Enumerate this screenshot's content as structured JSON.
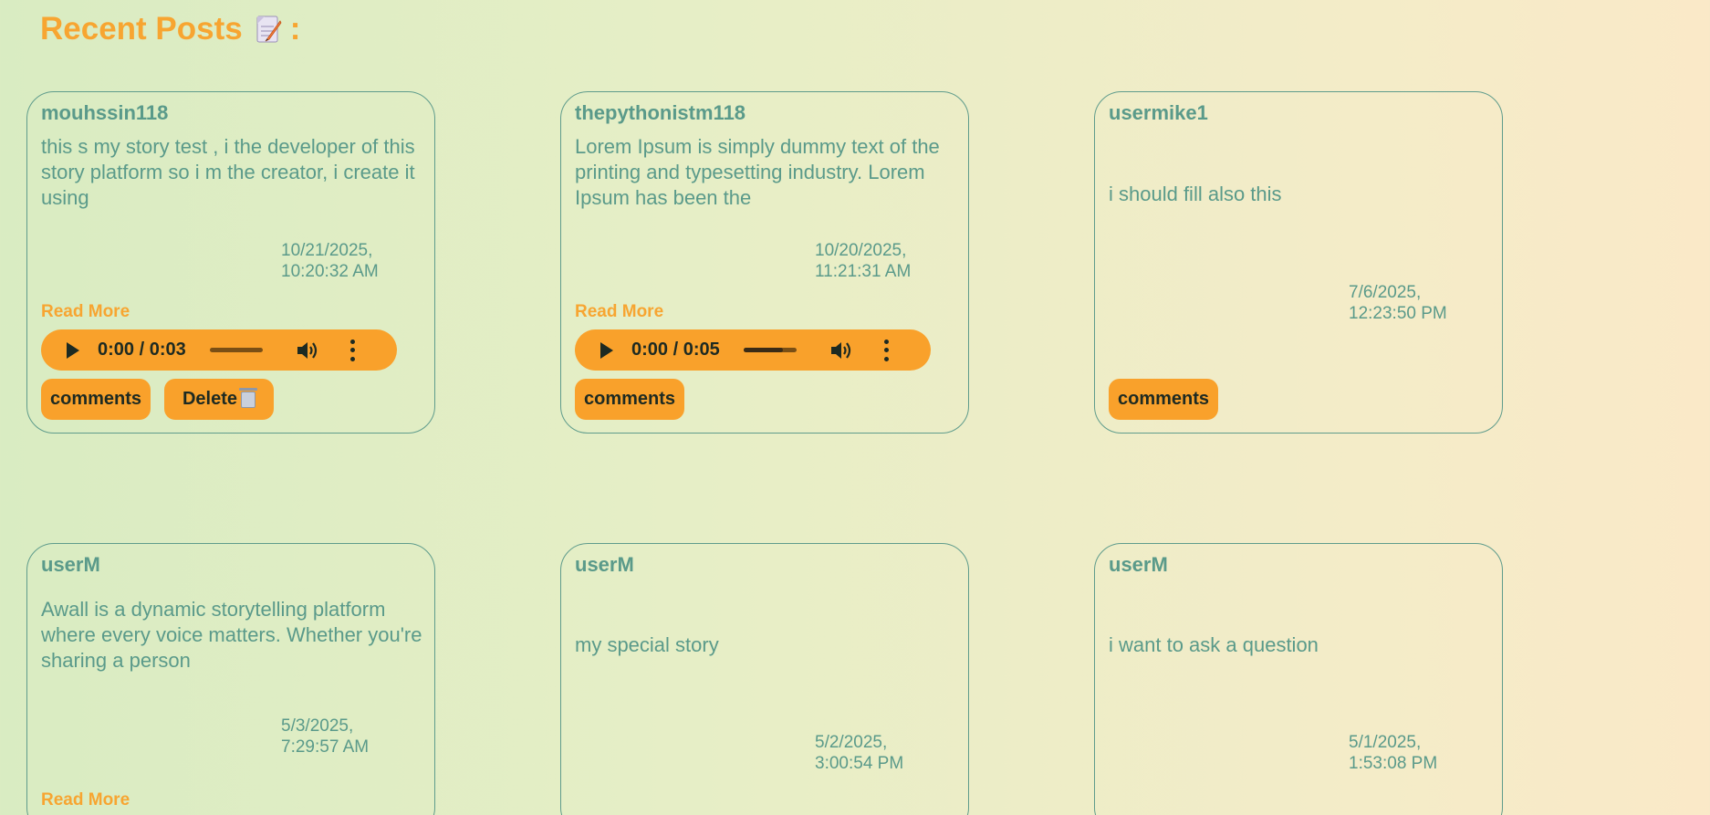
{
  "page": {
    "title": "Recent Posts",
    "title_suffix": ":",
    "title_icon": "memo-icon"
  },
  "colors": {
    "accent": "#f7a531",
    "button_bg": "#f9a12b",
    "text": "#5a9a8a",
    "card_border": "#5f9c8c"
  },
  "posts": [
    {
      "author": "mouhssin118",
      "body": "this s my story test , i the developer of this story platform so i m the creator, i create it using",
      "date_line1": "10/21/2025,",
      "date_line2": "10:20:32 AM",
      "read_more": "Read More",
      "audio": {
        "time": "0:00 / 0:03",
        "progress": 0
      },
      "comments_label": "comments",
      "delete_label": "Delete"
    },
    {
      "author": "thepythonistm118",
      "body": "Lorem Ipsum is simply dummy text of the printing and typesetting industry. Lorem Ipsum has been the",
      "date_line1": "10/20/2025,",
      "date_line2": "11:21:31 AM",
      "read_more": "Read More",
      "audio": {
        "time": "0:00 / 0:05",
        "progress": 0
      },
      "comments_label": "comments"
    },
    {
      "author": "usermike1",
      "body": "i should fill also this",
      "date_line1": "7/6/2025,",
      "date_line2": "12:23:50 PM",
      "comments_label": "comments"
    },
    {
      "author": "userM",
      "body": "Awall is a dynamic storytelling platform where every voice matters. Whether you're sharing a person",
      "date_line1": "5/3/2025,",
      "date_line2": "7:29:57 AM",
      "read_more": "Read More"
    },
    {
      "author": "userM",
      "body": "my special story",
      "date_line1": "5/2/2025,",
      "date_line2": "3:00:54 PM"
    },
    {
      "author": "userM",
      "body": "i want to ask a question",
      "date_line1": "5/1/2025,",
      "date_line2": "1:53:08 PM"
    }
  ]
}
